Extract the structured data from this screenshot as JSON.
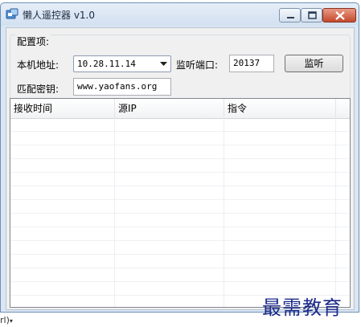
{
  "window": {
    "title": "懒人遥控器 v1.0",
    "minimize_icon": "minimize-icon",
    "maximize_icon": "maximize-icon",
    "close_icon": "close-icon"
  },
  "config": {
    "group_title": "配置项:",
    "local_address_label": "本机地址:",
    "local_address_value": "10.28.11.14",
    "listen_port_label": "监听端口:",
    "listen_port_value": "20137",
    "listen_button": "监听",
    "key_label": "匹配密钥:",
    "key_value": "www.yaofans.org"
  },
  "table": {
    "columns": [
      "接收时间",
      "源IP",
      "指令",
      ""
    ],
    "rows": []
  },
  "watermark": "最需教育",
  "bottom_fragment": "rl)"
}
